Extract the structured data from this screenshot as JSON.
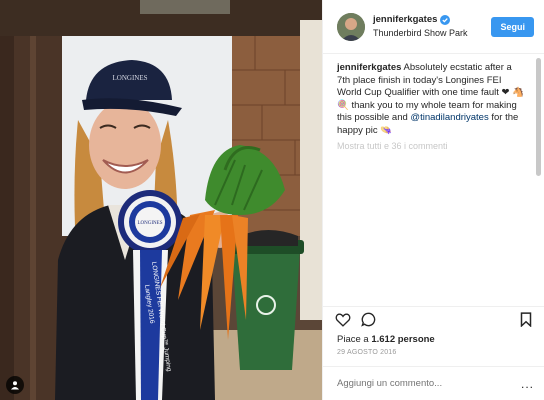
{
  "header": {
    "username": "jenniferkgates",
    "location": "Thunderbird Show Park",
    "follow_label": "Segui"
  },
  "caption": {
    "username": "jenniferkgates",
    "text_1": "Absolutely ecstatic after a 7th place finish in today's Longines FEI World Cup Qualifier with one time fault ❤",
    "text_2": "🐴🍭 thank you to my whole team for making this possible and",
    "mention": "@tinadilandriyates",
    "text_3": "for the happy pic 👒",
    "more_comments": "Mostra tutti e 36 i commenti"
  },
  "photo": {
    "cap_brand": "LONGINES",
    "rosette_brand": "LONGINES",
    "ribbon_text_1": "LONGINES FEI World Cup™ Jumping",
    "ribbon_text_2": "Langley 2016"
  },
  "stats": {
    "likes_prefix": "Piace a",
    "likes_count": "1.612",
    "likes_suffix": "persone",
    "date": "29 AGOSTO 2016"
  },
  "comment": {
    "placeholder": "Aggiungi un commento...",
    "more_label": "..."
  },
  "icons": {
    "like": "heart-icon",
    "comment": "comment-icon",
    "save": "bookmark-icon",
    "verified": "verified-badge-icon",
    "tagged": "person-tag-icon"
  },
  "colors": {
    "follow_button": "#3897f0",
    "verified_badge": "#3897f0",
    "mention": "#003569"
  }
}
